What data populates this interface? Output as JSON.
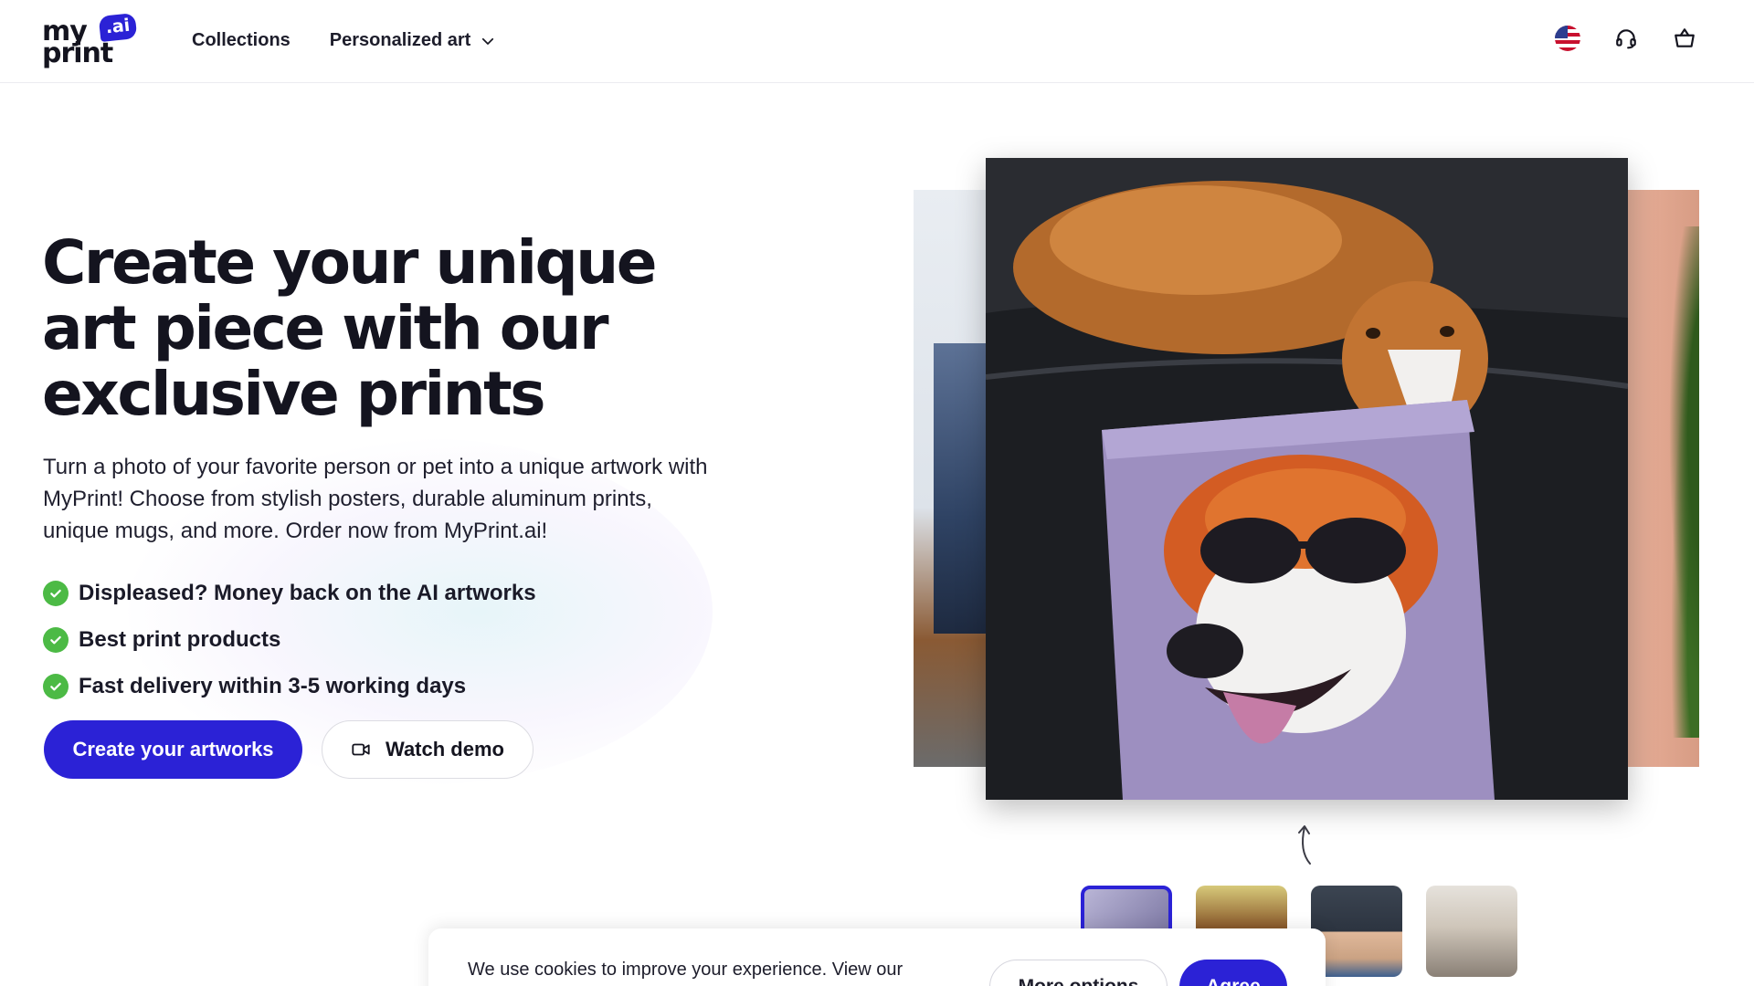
{
  "header": {
    "logo": {
      "line1": "my",
      "line2": "print",
      "badge": ".ai"
    },
    "nav": {
      "collections": "Collections",
      "personalized_art": "Personalized art"
    },
    "icons": [
      "us-flag-icon",
      "headset-icon",
      "shopping-basket-icon"
    ]
  },
  "hero": {
    "title": "Create your unique art piece with our exclusive prints",
    "description": "Turn a photo of your favorite person or pet into a unique artwork with MyPrint! Choose from stylish posters, durable aluminum prints, unique mugs, and more. Order now from MyPrint.ai!",
    "features": [
      "Displeased? Money back on the AI artworks",
      "Best print products",
      "Fast delivery within 3-5 working days"
    ],
    "primary_button": "Create your artworks",
    "secondary_button": "Watch demo"
  },
  "cookie_banner": {
    "text": "We use cookies to improve your experience. View our",
    "more_options": "More options",
    "agree": "Agree"
  },
  "colors": {
    "brand": "#2b22d6",
    "check": "#4cba45",
    "text": "#14141f"
  }
}
